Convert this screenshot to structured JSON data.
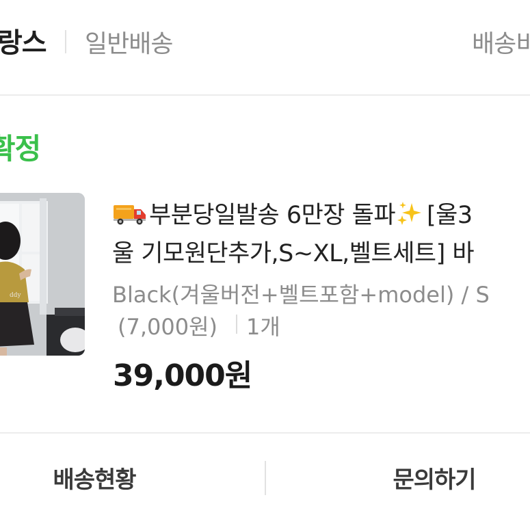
{
  "header": {
    "brand_partial": "랑스",
    "shipping_type": "일반배송",
    "right_link_partial": "배송비"
  },
  "order": {
    "status_partial": "확정"
  },
  "product": {
    "title_line1": "부분당일발송 6만장 돌파",
    "title_line1_suffix": "[울3",
    "title_line2": "울 기모원단추가,S~XL,벨트세트] 바",
    "option": "Black(겨울버전+벨트포함+model) / S",
    "option_extra_price": "(7,000원)",
    "quantity": "1개",
    "price": "39,000원",
    "icons": [
      "delivery-truck-icon",
      "sparkles-icon"
    ]
  },
  "actions": {
    "tracking_label": "배송현황",
    "inquiry_label": "문의하기"
  },
  "colors": {
    "status_green": "#3ac04b",
    "text_dark": "#222222",
    "text_gray": "#8c8c8c",
    "divider": "#ececec"
  }
}
